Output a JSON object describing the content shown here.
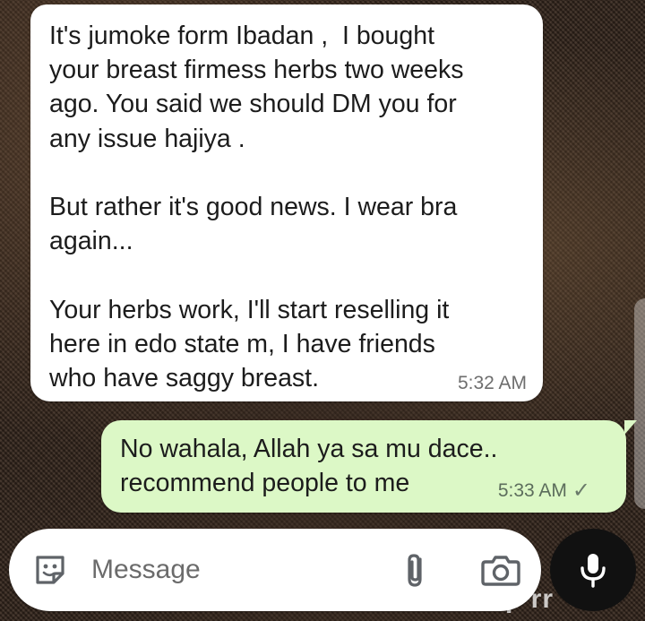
{
  "background": {
    "watermark_text": "ant-p rr"
  },
  "messages": [
    {
      "direction": "incoming",
      "text": "It's jumoke form Ibadan ,  I bought\nyour breast firmess herbs two weeks\nago. You said we should DM you for\nany issue hajiya .\n\nBut rather it's good news. I wear bra\nagain...\n\nYour herbs work, I'll start reselling it\nhere in edo state m, I have friends\nwho have saggy breast.",
      "time": "5:32 AM"
    },
    {
      "direction": "outgoing",
      "text": "No wahala, Allah ya sa mu dace..\nrecommend people to me",
      "time": "5:33 AM",
      "status_icon": "single-check-icon"
    }
  ],
  "composer": {
    "placeholder": "Message",
    "left_icon": "sticker-icon",
    "attach_icon": "paperclip-icon",
    "camera_icon": "camera-icon",
    "send_icon": "microphone-icon"
  },
  "colors": {
    "incoming_bubble": "#ffffff",
    "outgoing_bubble": "#dcf8c6",
    "mic_button": "#111111"
  }
}
